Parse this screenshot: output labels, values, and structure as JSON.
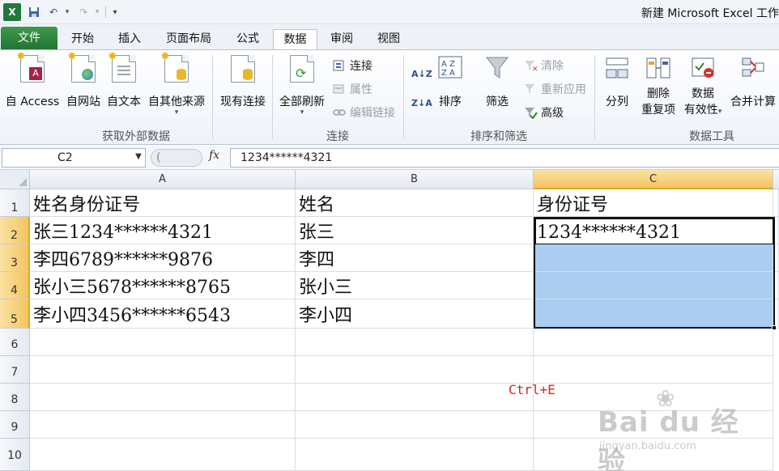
{
  "window": {
    "title": "新建 Microsoft Excel 工作",
    "app_logo": "X"
  },
  "quick_access": {
    "icons": [
      "excel-logo-icon",
      "save-icon",
      "undo-icon",
      "redo-icon",
      "customize-icon"
    ]
  },
  "tabs": [
    {
      "label": "文件"
    },
    {
      "label": "开始"
    },
    {
      "label": "插入"
    },
    {
      "label": "页面布局"
    },
    {
      "label": "公式"
    },
    {
      "label": "数据"
    },
    {
      "label": "审阅"
    },
    {
      "label": "视图"
    }
  ],
  "active_tab": "数据",
  "ribbon": {
    "external": {
      "group_label": "获取外部数据",
      "buttons": [
        "自 Access",
        "自网站",
        "自文本",
        "自其他来源",
        "现有连接"
      ]
    },
    "connections": {
      "group_label": "连接",
      "refresh_label": "全部刷新",
      "items": [
        "连接",
        "属性",
        "编辑链接"
      ]
    },
    "sort_filter": {
      "group_label": "排序和筛选",
      "sort_label": "排序",
      "filter_label": "筛选",
      "items": [
        "清除",
        "重新应用",
        "高级"
      ]
    },
    "data_tools": {
      "group_label": "数据工具",
      "split_label": "分列",
      "remove_dup_line1": "删除",
      "remove_dup_line2": "重复项",
      "validation_line1": "数据",
      "validation_line2": "有效性",
      "consolidate_label": "合并计算"
    }
  },
  "formula_bar": {
    "name_box": "C2",
    "fx_label": "fx",
    "formula": "1234******4321"
  },
  "sheet": {
    "columns": [
      "A",
      "B",
      "C"
    ],
    "rows": [
      "1",
      "2",
      "3",
      "4",
      "5",
      "6",
      "7",
      "8",
      "9",
      "10"
    ],
    "cells": {
      "A1": "姓名身份证号",
      "B1": "姓名",
      "C1": "身份证号",
      "A2": "张三1234******4321",
      "B2": "张三",
      "C2": "1234******4321",
      "A3": "李四6789******9876",
      "B3": "李四",
      "C3": "",
      "A4": "张小三5678******8765",
      "B4": "张小三",
      "C4": "",
      "A5": "李小四3456******6543",
      "B5": "李小四",
      "C5": ""
    }
  },
  "annotation": "Ctrl+E",
  "watermark": {
    "main": "Bai du 经验",
    "sub": "jingyan.baidu.com"
  }
}
